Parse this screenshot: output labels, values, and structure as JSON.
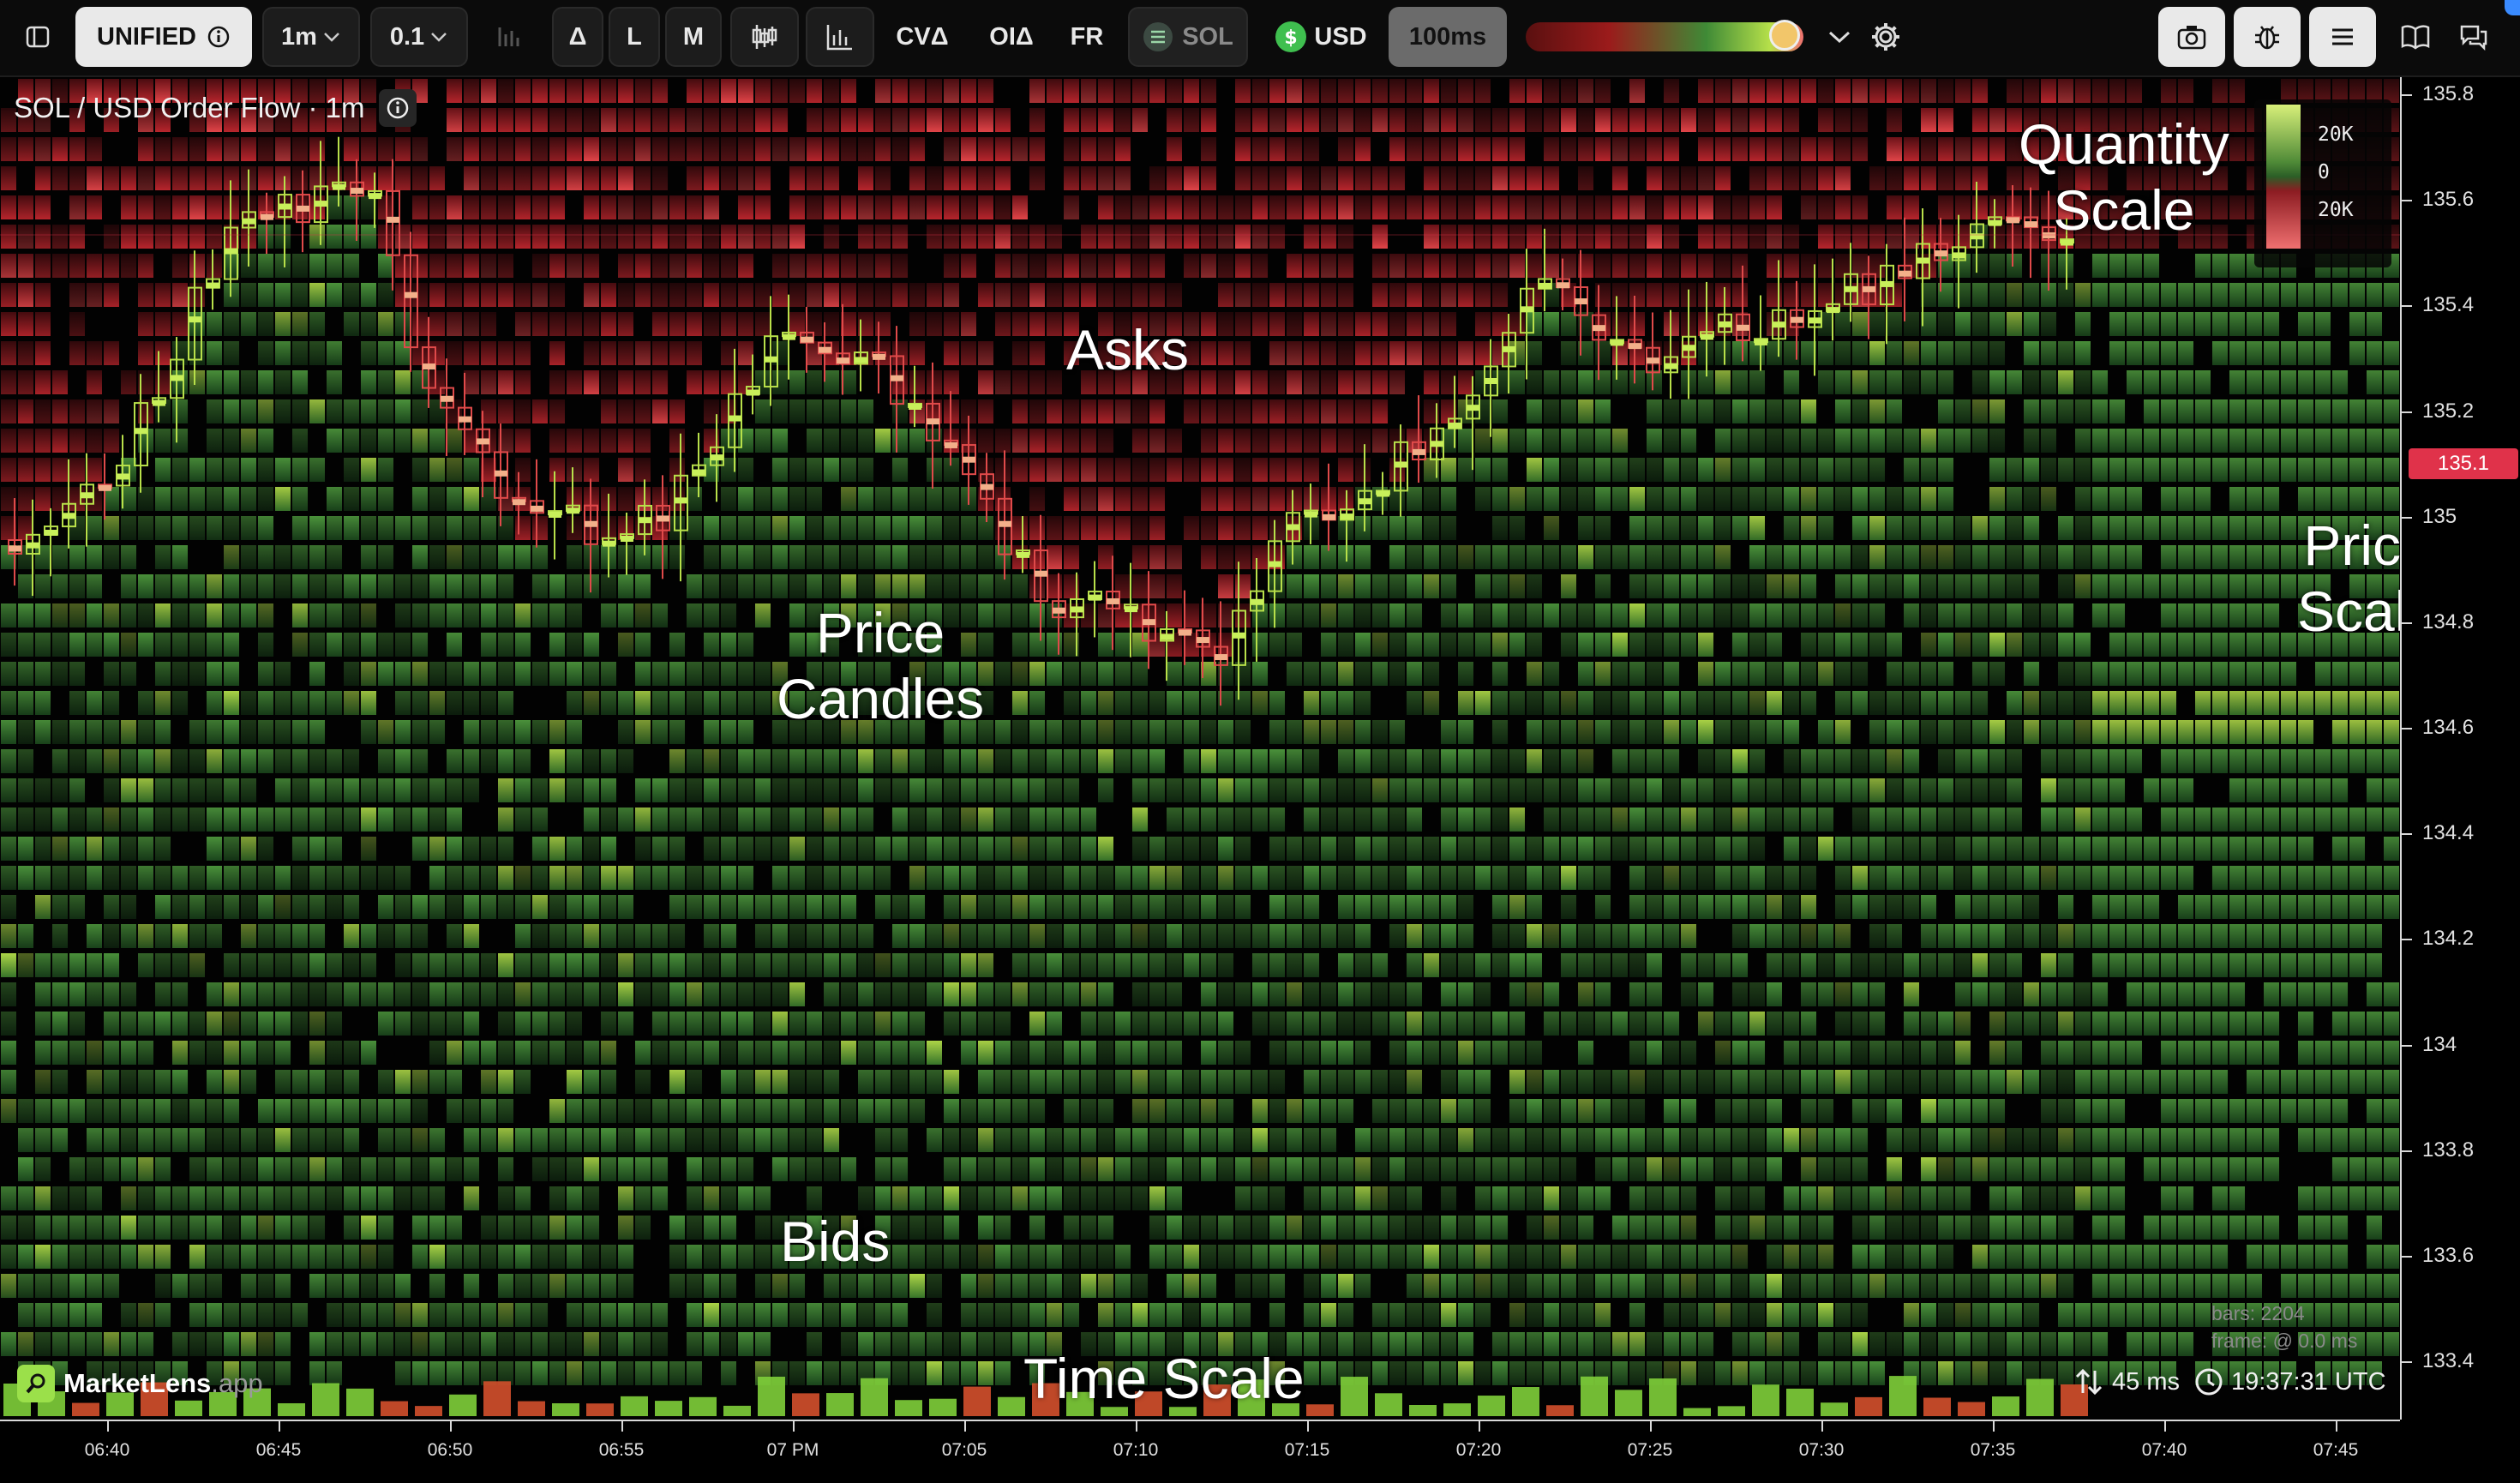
{
  "toolbar": {
    "unified": "UNIFIED",
    "interval": "1m",
    "tick": "0.1",
    "delta": "Δ",
    "l": "L",
    "m": "M",
    "cvd": "CVΔ",
    "oid": "OIΔ",
    "fr": "FR",
    "asset": "SOL",
    "quote": "USD",
    "speed": "100ms"
  },
  "chart": {
    "title": "SOL / USD Order Flow · 1m",
    "current_price": "135.1",
    "price_ticks": [
      "135.8",
      "135.6",
      "135.4",
      "135.2",
      "135",
      "134.8",
      "134.6",
      "134.4",
      "134.2",
      "134",
      "133.8",
      "133.6",
      "133.4"
    ],
    "time_ticks": [
      "06:40",
      "06:45",
      "06:50",
      "06:55",
      "07 PM",
      "07:05",
      "07:10",
      "07:15",
      "07:20",
      "07:25",
      "07:30",
      "07:35",
      "07:40",
      "07:45"
    ],
    "quantity_scale": {
      "top": "20K",
      "mid": "0",
      "bottom": "20K"
    }
  },
  "annotations": {
    "asks": "Asks",
    "bids": "Bids",
    "price_candles_1": "Price",
    "price_candles_2": "Candles",
    "quantity_scale_1": "Quantity",
    "quantity_scale_2": "Scale",
    "price_scale_1": "Price",
    "price_scale_2": "Scale",
    "time_scale": "Time Scale"
  },
  "footer": {
    "logo": "MarketLens",
    "logo_suffix": ".app",
    "latency": "45 ms",
    "clock": "19:37:31 UTC",
    "bars": "bars: 2204",
    "frame": "frame: @ 0.0 ms"
  },
  "colors": {
    "ask": "#a02028",
    "bid": "#3f8a36",
    "current_price_badge": "#e0324a",
    "unified_bg": "#e9e9e9",
    "logo_accent": "#9be04a"
  }
}
